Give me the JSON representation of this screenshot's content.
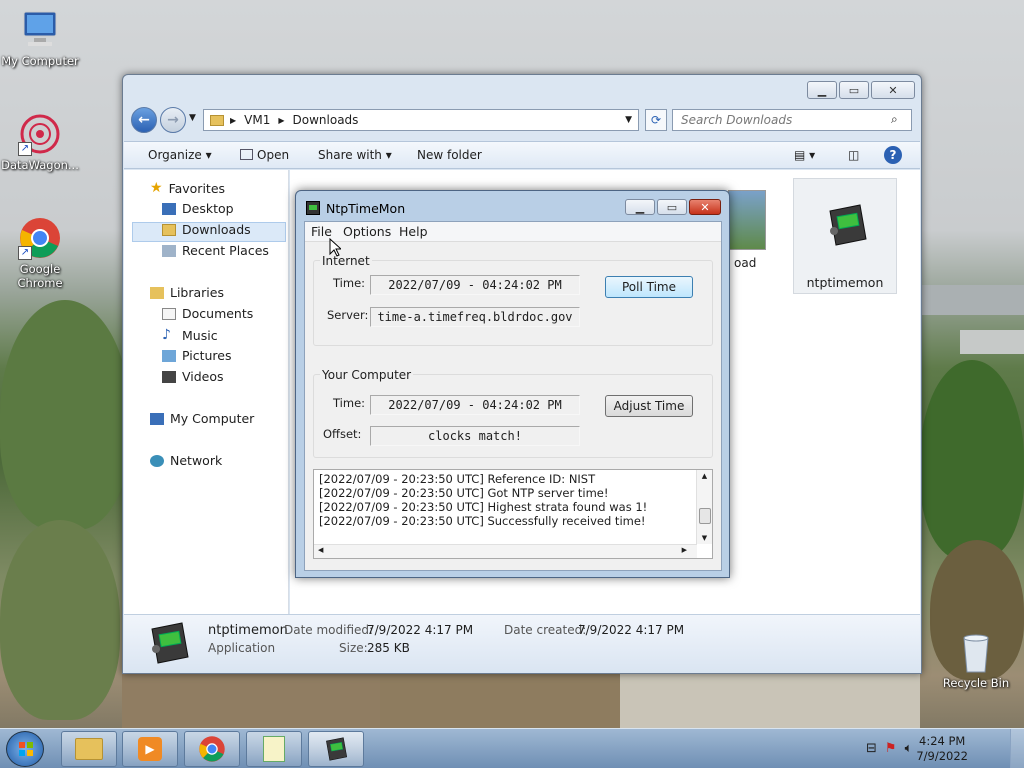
{
  "desktop": {
    "icons": [
      {
        "label": "My Computer"
      },
      {
        "label": "DataWagon..."
      },
      {
        "label": "Google Chrome"
      },
      {
        "label": "Recycle Bin"
      }
    ]
  },
  "explorer": {
    "address": {
      "crumbs": [
        "VM1",
        "Downloads"
      ]
    },
    "search": {
      "placeholder": "Search Downloads"
    },
    "toolbar": {
      "organize": "Organize",
      "open": "Open",
      "share_with": "Share with",
      "new_folder": "New folder"
    },
    "nav": {
      "favorites": "Favorites",
      "desktop": "Desktop",
      "downloads": "Downloads",
      "recent_places": "Recent Places",
      "libraries": "Libraries",
      "documents": "Documents",
      "music": "Music",
      "pictures": "Pictures",
      "videos": "Videos",
      "my_computer": "My Computer",
      "network": "Network"
    },
    "files": [
      {
        "label": "oad"
      },
      {
        "label": "ntptimemon"
      }
    ],
    "details": {
      "name": "ntptimemon",
      "type": "Application",
      "modified_label": "Date modified:",
      "modified_value": "7/9/2022 4:17 PM",
      "created_label": "Date created:",
      "created_value": "7/9/2022 4:17 PM",
      "size_label": "Size:",
      "size_value": "285 KB"
    }
  },
  "ntp": {
    "title": "NtpTimeMon",
    "menu": {
      "file": "File",
      "options": "Options",
      "help": "Help"
    },
    "internet": {
      "group": "Internet",
      "time_label": "Time:",
      "time_value": "2022/07/09 - 04:24:02 PM",
      "server_label": "Server:",
      "server_value": "time-a.timefreq.bldrdoc.gov",
      "poll_button": "Poll Time"
    },
    "computer": {
      "group": "Your Computer",
      "time_label": "Time:",
      "time_value": "2022/07/09 - 04:24:02 PM",
      "offset_label": "Offset:",
      "offset_value": "clocks match!",
      "adjust_button": "Adjust Time"
    },
    "log": [
      "[2022/07/09 - 20:23:50 UTC]     Reference ID: NIST",
      "[2022/07/09 - 20:23:50 UTC] Got NTP server time!",
      "[2022/07/09 - 20:23:50 UTC] Highest strata found was 1!",
      "[2022/07/09 - 20:23:50 UTC] Successfully received time!"
    ]
  },
  "taskbar": {
    "clock": {
      "time": "4:24 PM",
      "date": "7/9/2022"
    }
  },
  "colors": {
    "accent": "#3c7fb1",
    "selection": "#dbe9f8",
    "log_text": "#1e1e1e"
  }
}
